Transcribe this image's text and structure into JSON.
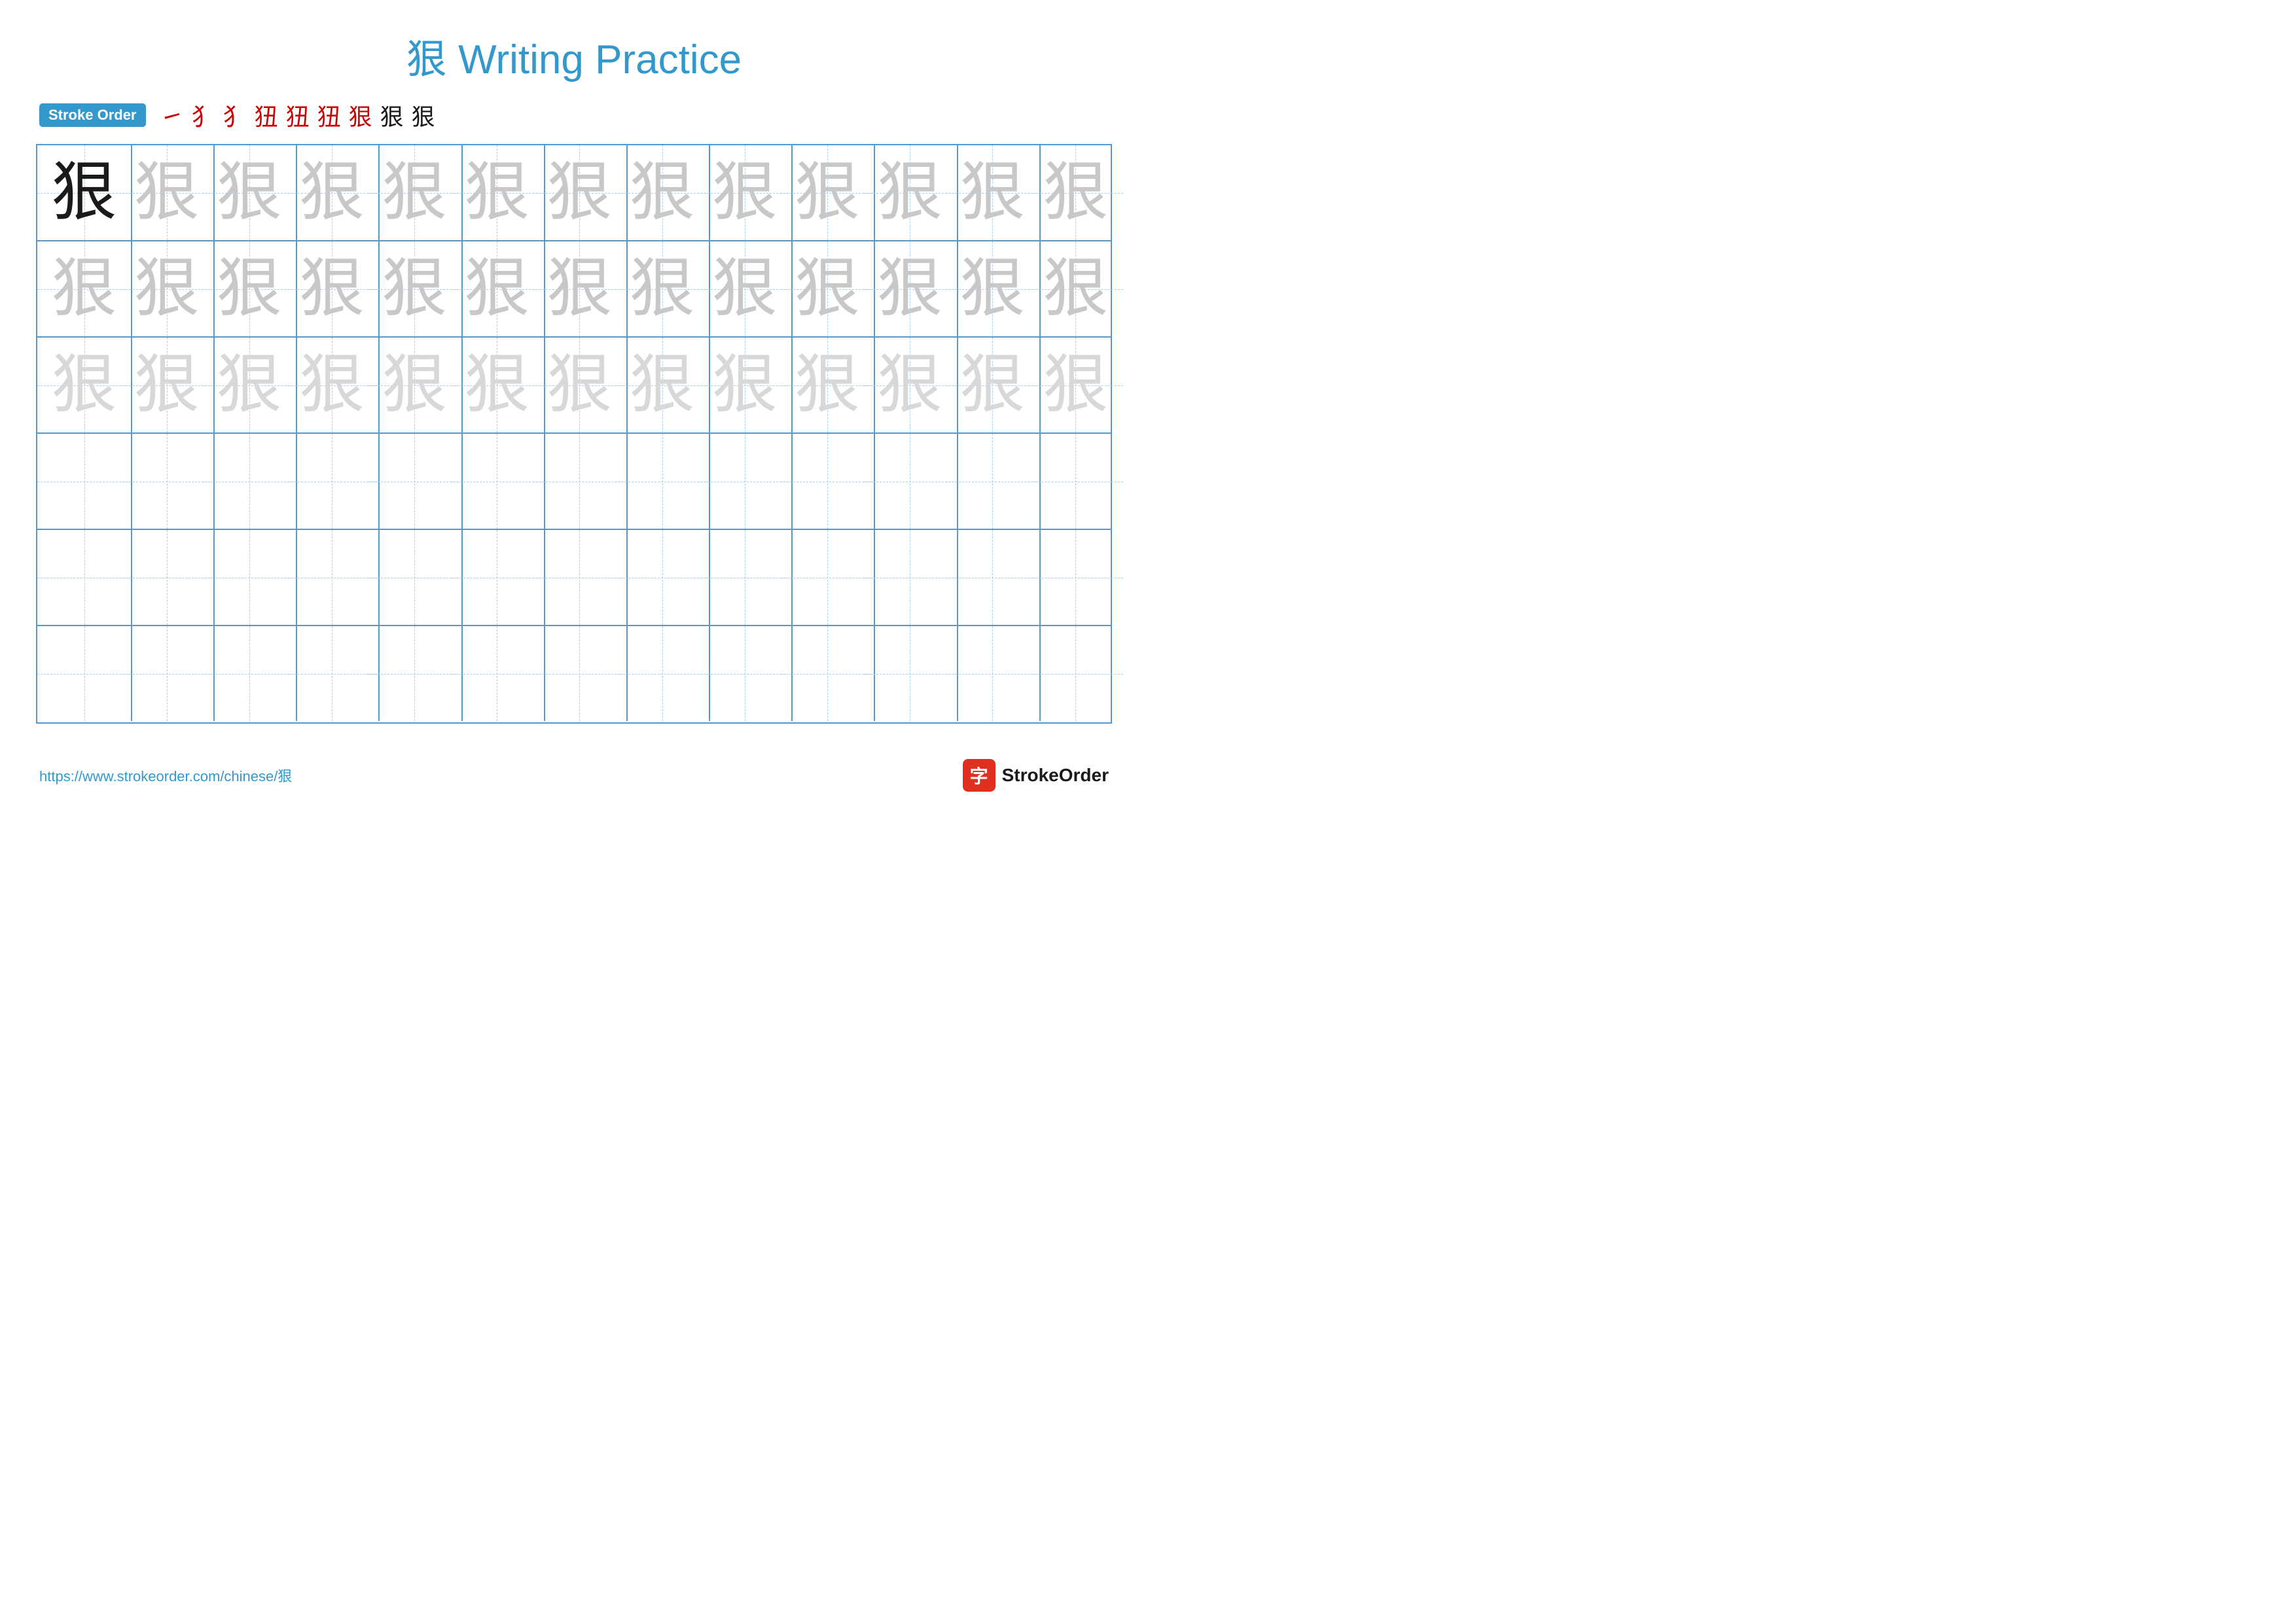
{
  "title": "狠 Writing Practice",
  "stroke_order": {
    "label": "Stroke Order",
    "steps": [
      "㇐",
      "犭",
      "犭",
      "犭犮",
      "犭犮",
      "犭犮",
      "犭狠",
      "狠犮",
      "狠"
    ]
  },
  "character": "狠",
  "grid": {
    "rows": 6,
    "cols": 13,
    "row_styles": [
      [
        "dark",
        "medium",
        "medium",
        "medium",
        "medium",
        "medium",
        "medium",
        "medium",
        "medium",
        "medium",
        "medium",
        "medium",
        "medium"
      ],
      [
        "medium",
        "medium",
        "medium",
        "medium",
        "medium",
        "medium",
        "medium",
        "medium",
        "medium",
        "medium",
        "medium",
        "medium",
        "medium"
      ],
      [
        "light",
        "light",
        "light",
        "light",
        "light",
        "light",
        "light",
        "light",
        "light",
        "light",
        "light",
        "light",
        "light"
      ],
      [
        "none",
        "none",
        "none",
        "none",
        "none",
        "none",
        "none",
        "none",
        "none",
        "none",
        "none",
        "none",
        "none"
      ],
      [
        "none",
        "none",
        "none",
        "none",
        "none",
        "none",
        "none",
        "none",
        "none",
        "none",
        "none",
        "none",
        "none"
      ],
      [
        "none",
        "none",
        "none",
        "none",
        "none",
        "none",
        "none",
        "none",
        "none",
        "none",
        "none",
        "none",
        "none"
      ]
    ]
  },
  "footer": {
    "url": "https://www.strokeorder.com/chinese/狠",
    "brand_name": "StrokeOrder",
    "brand_icon": "字"
  }
}
